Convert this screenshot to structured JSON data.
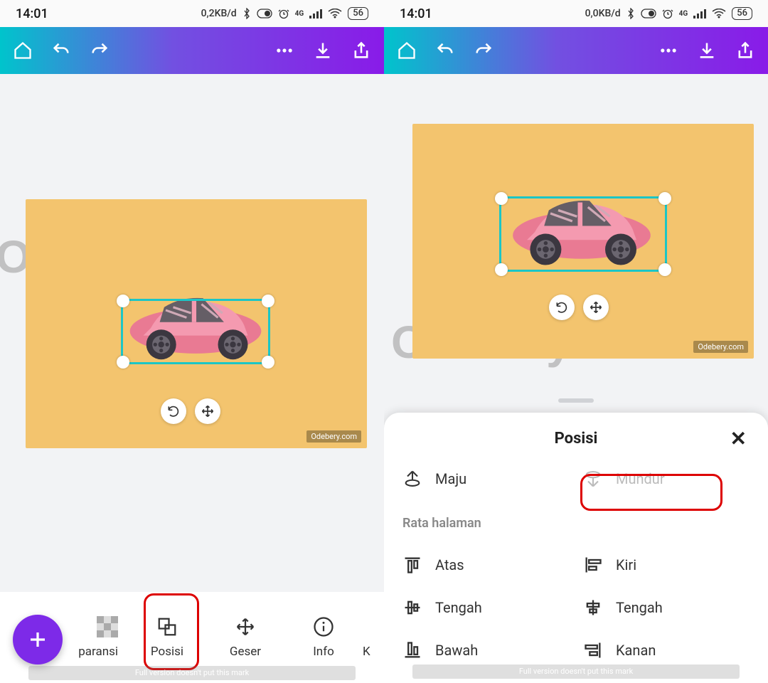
{
  "status": {
    "time_left": "14:01",
    "net_left": "0,2KB/d",
    "batt_left": "56",
    "time_right": "14:01",
    "net_right": "0,0KB/d",
    "batt_right": "56"
  },
  "watermark": {
    "text": "Odebery.com",
    "mark": "Odebery.com"
  },
  "tools": {
    "t0": "paransi",
    "t1": "Posisi",
    "t2": "Geser",
    "t3": "Info",
    "t4": "K"
  },
  "sheet": {
    "title": "Posisi",
    "maju": "Maju",
    "mundur": "Mundur",
    "section": "Rata halaman",
    "atas": "Atas",
    "kiri": "Kiri",
    "tengahV": "Tengah",
    "tengahH": "Tengah",
    "bawah": "Bawah",
    "kanan": "Kanan"
  },
  "fine": "Full version doesn't put this mark"
}
